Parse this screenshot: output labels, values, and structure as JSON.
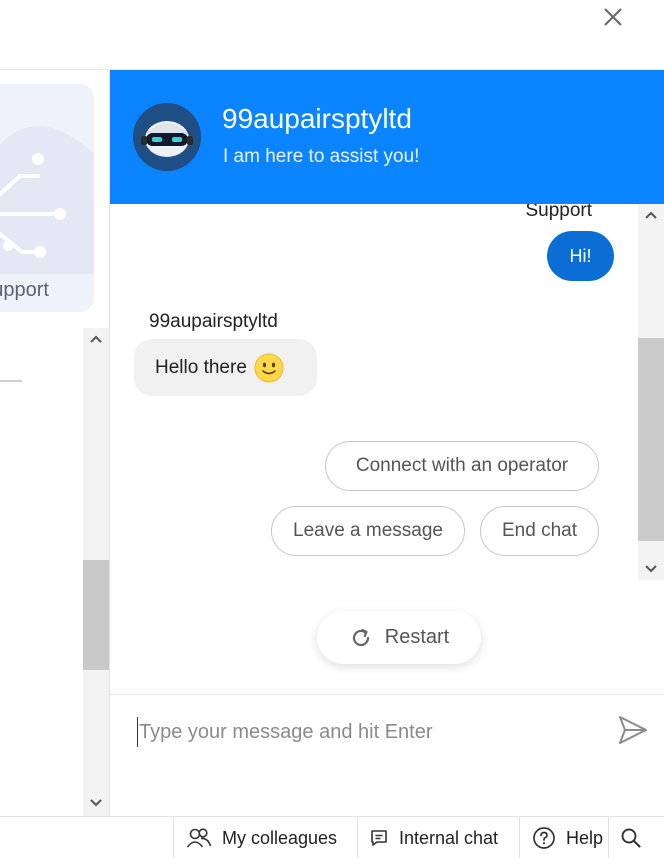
{
  "window": {
    "close_icon": "close-icon"
  },
  "background_pane": {
    "support_card_label": "Support"
  },
  "chat": {
    "bot_name": "99aupairsptyltd",
    "tagline": "I am here to assist you!",
    "messages": [
      {
        "sender": "Support",
        "text": "Hi!",
        "side": "right"
      },
      {
        "sender": "99aupairsptyltd",
        "text": "Hello there",
        "side": "left",
        "emoji": "slightly-smiling-face"
      }
    ],
    "quick_replies": [
      "Connect with an operator",
      "Leave a message",
      "End chat"
    ],
    "restart_label": "Restart",
    "input_placeholder": "Type your message and hit Enter",
    "input_value": ""
  },
  "bottom_bar": {
    "items": [
      {
        "label": "My colleagues",
        "icon": "people-icon"
      },
      {
        "label": "Internal chat",
        "icon": "chat-icon"
      },
      {
        "label": "Help",
        "icon": "help-icon"
      },
      {
        "label": "",
        "icon": "search-icon"
      }
    ]
  },
  "colors": {
    "header_blue": "#0a85ff",
    "user_bubble": "#0a6ed6",
    "bot_bubble": "#f1f1f1",
    "avatar_bg": "#1f4f84"
  }
}
